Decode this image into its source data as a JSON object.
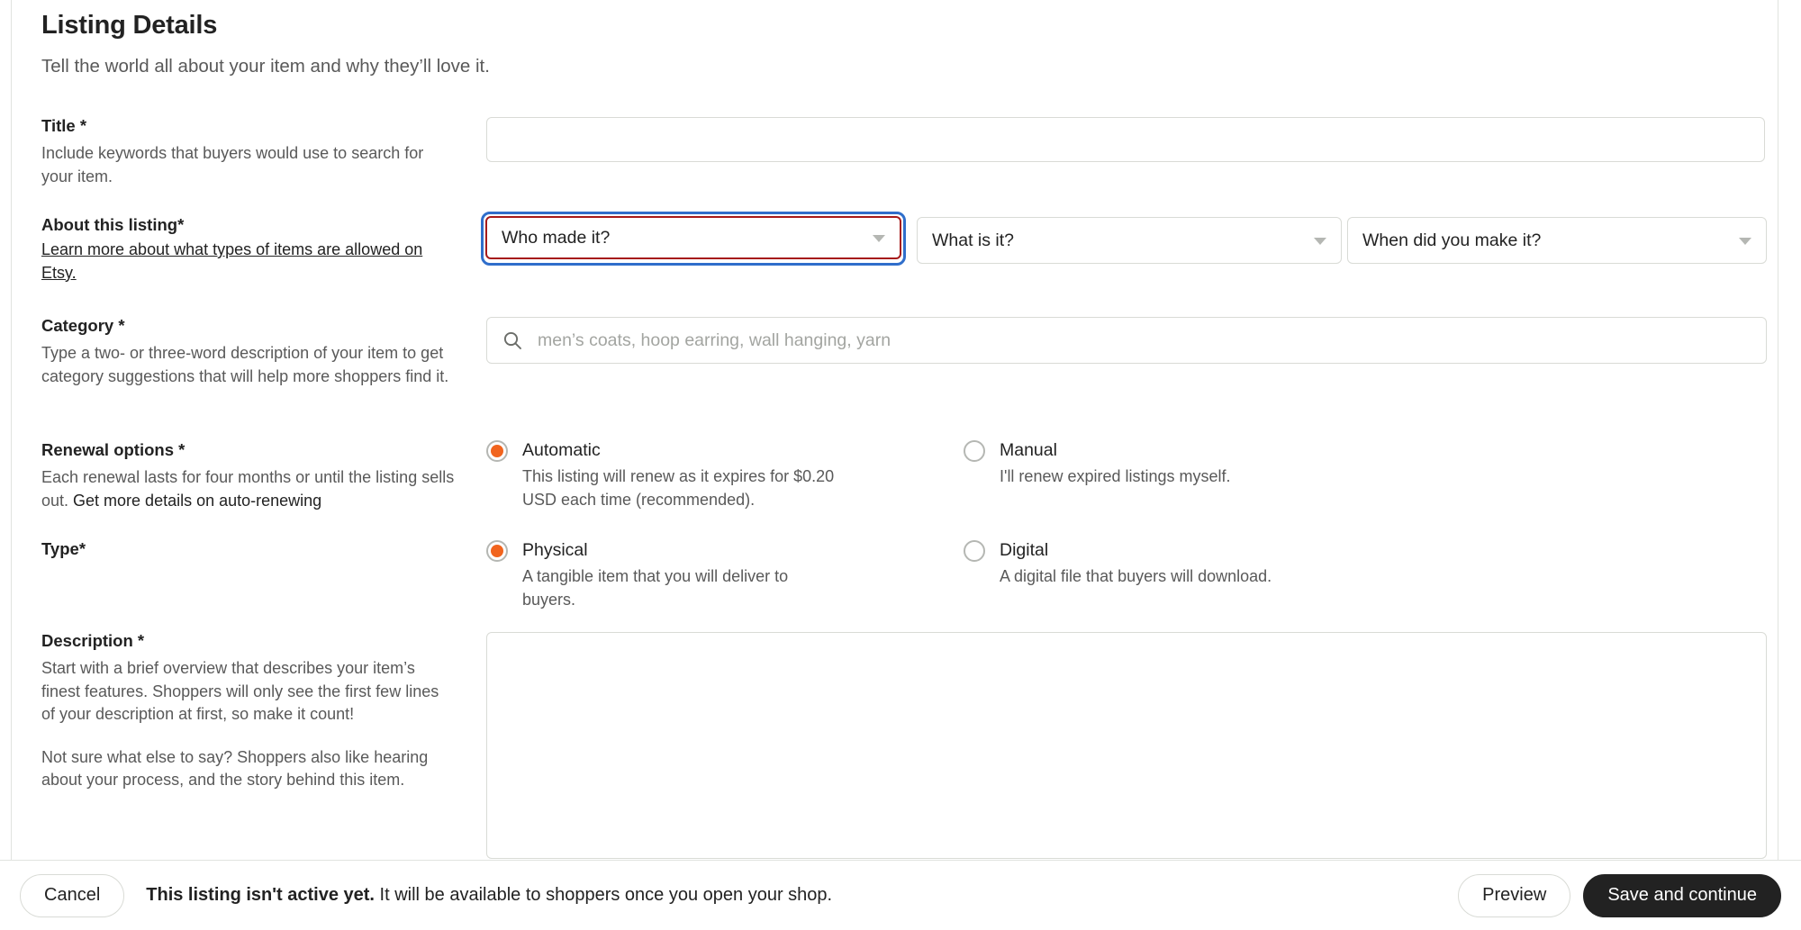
{
  "page": {
    "title": "Listing Details",
    "subtitle": "Tell the world all about your item and why they’ll love it."
  },
  "fields": {
    "title": {
      "label": "Title",
      "required_mark": "*",
      "help": "Include keywords that buyers would use to search for your item.",
      "value": "",
      "placeholder": ""
    },
    "about": {
      "label": "About this listing",
      "required_mark": "*",
      "link_text": "Learn more about what types of items are allowed on Etsy.",
      "dropdowns": [
        {
          "name": "who-made-it",
          "value": "Who made it?",
          "state": "focused-error"
        },
        {
          "name": "what-is-it",
          "value": "What is it?",
          "state": "default"
        },
        {
          "name": "when-did-you-make-it",
          "value": "When did you make it?",
          "state": "default"
        }
      ]
    },
    "category": {
      "label": "Category",
      "required_mark": "*",
      "help": "Type a two- or three-word description of your item to get category suggestions that will help more shoppers find it.",
      "value": "",
      "placeholder": "men’s coats, hoop earring, wall hanging, yarn",
      "icon": "search-icon"
    },
    "renewal": {
      "label": "Renewal options",
      "required_mark": "*",
      "help_prefix": "Each renewal lasts for four months or until the listing sells out. ",
      "help_link": "Get more details on auto-renewing",
      "options": [
        {
          "name": "automatic",
          "title": "Automatic",
          "desc": "This listing will renew as it expires for $0.20 USD each time (recommended).",
          "checked": true
        },
        {
          "name": "manual",
          "title": "Manual",
          "desc": "I'll renew expired listings myself.",
          "checked": false
        }
      ]
    },
    "type": {
      "label": "Type",
      "required_mark": "*",
      "options": [
        {
          "name": "physical",
          "title": "Physical",
          "desc": "A tangible item that you will deliver to buyers.",
          "checked": true
        },
        {
          "name": "digital",
          "title": "Digital",
          "desc": "A digital file that buyers will download.",
          "checked": false
        }
      ]
    },
    "description": {
      "label": "Description",
      "required_mark": "*",
      "help_1": "Start with a brief overview that describes your item’s finest features. Shoppers will only see the first few lines of your description at first, so make it count!",
      "help_2": "Not sure what else to say? Shoppers also like hearing about your process, and the story behind this item.",
      "value": "",
      "placeholder": ""
    }
  },
  "footer": {
    "cancel_label": "Cancel",
    "status_strong": "This listing isn't active yet.",
    "status_rest": " It will be available to shoppers once you open your shop.",
    "preview_label": "Preview",
    "save_label": "Save and continue"
  },
  "colors": {
    "accent_orange": "#f1641e",
    "focus_blue": "#2f6ecb",
    "error_red": "#a61a1a",
    "dark_button": "#222222",
    "border": "#d9dbd6"
  }
}
